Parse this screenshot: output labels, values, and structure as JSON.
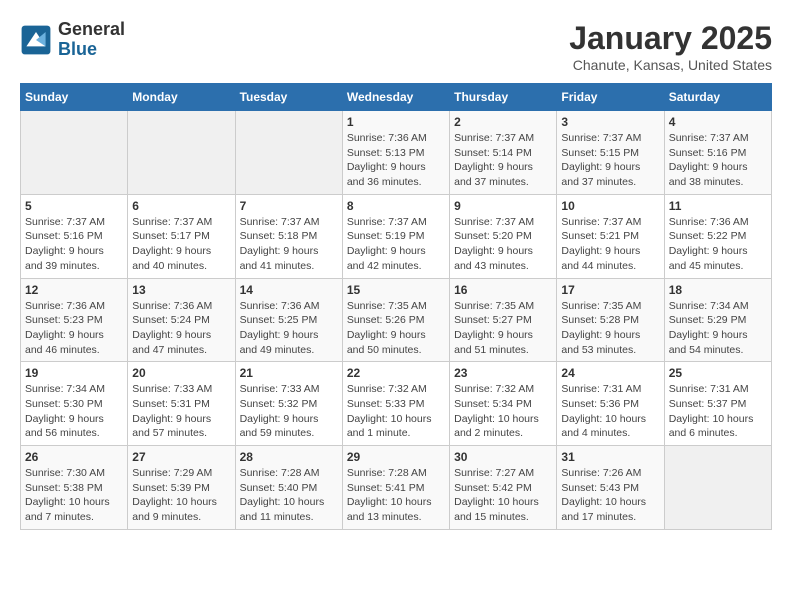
{
  "logo": {
    "general": "General",
    "blue": "Blue"
  },
  "title": "January 2025",
  "location": "Chanute, Kansas, United States",
  "days_of_week": [
    "Sunday",
    "Monday",
    "Tuesday",
    "Wednesday",
    "Thursday",
    "Friday",
    "Saturday"
  ],
  "weeks": [
    [
      {
        "day": "",
        "info": ""
      },
      {
        "day": "",
        "info": ""
      },
      {
        "day": "",
        "info": ""
      },
      {
        "day": "1",
        "info": "Sunrise: 7:36 AM\nSunset: 5:13 PM\nDaylight: 9 hours and 36 minutes."
      },
      {
        "day": "2",
        "info": "Sunrise: 7:37 AM\nSunset: 5:14 PM\nDaylight: 9 hours and 37 minutes."
      },
      {
        "day": "3",
        "info": "Sunrise: 7:37 AM\nSunset: 5:15 PM\nDaylight: 9 hours and 37 minutes."
      },
      {
        "day": "4",
        "info": "Sunrise: 7:37 AM\nSunset: 5:16 PM\nDaylight: 9 hours and 38 minutes."
      }
    ],
    [
      {
        "day": "5",
        "info": "Sunrise: 7:37 AM\nSunset: 5:16 PM\nDaylight: 9 hours and 39 minutes."
      },
      {
        "day": "6",
        "info": "Sunrise: 7:37 AM\nSunset: 5:17 PM\nDaylight: 9 hours and 40 minutes."
      },
      {
        "day": "7",
        "info": "Sunrise: 7:37 AM\nSunset: 5:18 PM\nDaylight: 9 hours and 41 minutes."
      },
      {
        "day": "8",
        "info": "Sunrise: 7:37 AM\nSunset: 5:19 PM\nDaylight: 9 hours and 42 minutes."
      },
      {
        "day": "9",
        "info": "Sunrise: 7:37 AM\nSunset: 5:20 PM\nDaylight: 9 hours and 43 minutes."
      },
      {
        "day": "10",
        "info": "Sunrise: 7:37 AM\nSunset: 5:21 PM\nDaylight: 9 hours and 44 minutes."
      },
      {
        "day": "11",
        "info": "Sunrise: 7:36 AM\nSunset: 5:22 PM\nDaylight: 9 hours and 45 minutes."
      }
    ],
    [
      {
        "day": "12",
        "info": "Sunrise: 7:36 AM\nSunset: 5:23 PM\nDaylight: 9 hours and 46 minutes."
      },
      {
        "day": "13",
        "info": "Sunrise: 7:36 AM\nSunset: 5:24 PM\nDaylight: 9 hours and 47 minutes."
      },
      {
        "day": "14",
        "info": "Sunrise: 7:36 AM\nSunset: 5:25 PM\nDaylight: 9 hours and 49 minutes."
      },
      {
        "day": "15",
        "info": "Sunrise: 7:35 AM\nSunset: 5:26 PM\nDaylight: 9 hours and 50 minutes."
      },
      {
        "day": "16",
        "info": "Sunrise: 7:35 AM\nSunset: 5:27 PM\nDaylight: 9 hours and 51 minutes."
      },
      {
        "day": "17",
        "info": "Sunrise: 7:35 AM\nSunset: 5:28 PM\nDaylight: 9 hours and 53 minutes."
      },
      {
        "day": "18",
        "info": "Sunrise: 7:34 AM\nSunset: 5:29 PM\nDaylight: 9 hours and 54 minutes."
      }
    ],
    [
      {
        "day": "19",
        "info": "Sunrise: 7:34 AM\nSunset: 5:30 PM\nDaylight: 9 hours and 56 minutes."
      },
      {
        "day": "20",
        "info": "Sunrise: 7:33 AM\nSunset: 5:31 PM\nDaylight: 9 hours and 57 minutes."
      },
      {
        "day": "21",
        "info": "Sunrise: 7:33 AM\nSunset: 5:32 PM\nDaylight: 9 hours and 59 minutes."
      },
      {
        "day": "22",
        "info": "Sunrise: 7:32 AM\nSunset: 5:33 PM\nDaylight: 10 hours and 1 minute."
      },
      {
        "day": "23",
        "info": "Sunrise: 7:32 AM\nSunset: 5:34 PM\nDaylight: 10 hours and 2 minutes."
      },
      {
        "day": "24",
        "info": "Sunrise: 7:31 AM\nSunset: 5:36 PM\nDaylight: 10 hours and 4 minutes."
      },
      {
        "day": "25",
        "info": "Sunrise: 7:31 AM\nSunset: 5:37 PM\nDaylight: 10 hours and 6 minutes."
      }
    ],
    [
      {
        "day": "26",
        "info": "Sunrise: 7:30 AM\nSunset: 5:38 PM\nDaylight: 10 hours and 7 minutes."
      },
      {
        "day": "27",
        "info": "Sunrise: 7:29 AM\nSunset: 5:39 PM\nDaylight: 10 hours and 9 minutes."
      },
      {
        "day": "28",
        "info": "Sunrise: 7:28 AM\nSunset: 5:40 PM\nDaylight: 10 hours and 11 minutes."
      },
      {
        "day": "29",
        "info": "Sunrise: 7:28 AM\nSunset: 5:41 PM\nDaylight: 10 hours and 13 minutes."
      },
      {
        "day": "30",
        "info": "Sunrise: 7:27 AM\nSunset: 5:42 PM\nDaylight: 10 hours and 15 minutes."
      },
      {
        "day": "31",
        "info": "Sunrise: 7:26 AM\nSunset: 5:43 PM\nDaylight: 10 hours and 17 minutes."
      },
      {
        "day": "",
        "info": ""
      }
    ]
  ]
}
